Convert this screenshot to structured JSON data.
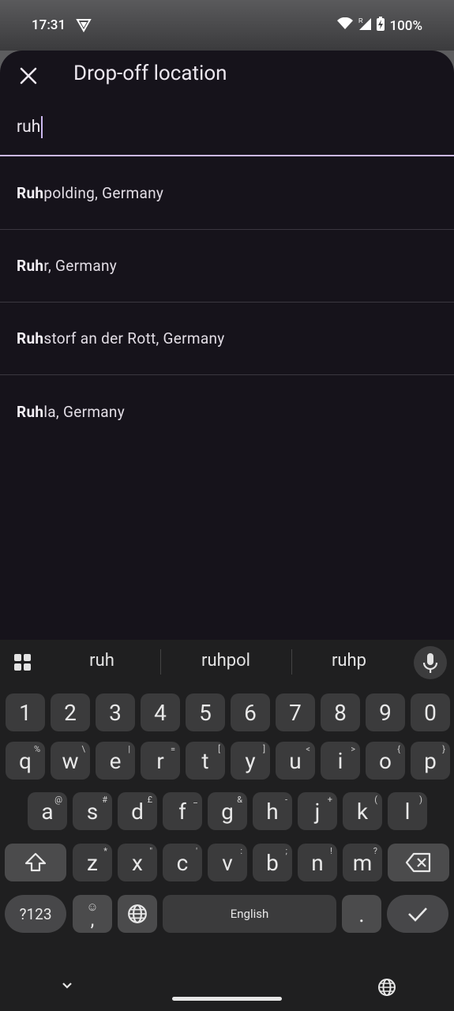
{
  "status_bar": {
    "time": "17:31",
    "battery": "100%",
    "vpn_icon": "vpn-shield-icon",
    "wifi_icon": "wifi-icon",
    "signal_icon": "signal-roaming-icon",
    "battery_icon": "battery-charging-icon"
  },
  "sheet": {
    "title": "Drop-off location",
    "close_icon": "close-icon"
  },
  "search": {
    "value": "ruh"
  },
  "results": [
    {
      "match": "Ruh",
      "rest": "polding, Germany"
    },
    {
      "match": "Ruh",
      "rest": "r, Germany"
    },
    {
      "match": "Ruh",
      "rest": "storf an der Rott, Germany"
    },
    {
      "match": "Ruh",
      "rest": "la, Germany"
    }
  ],
  "keyboard": {
    "suggestions": [
      "ruh",
      "ruhpol",
      "ruhp"
    ],
    "numbers": [
      "1",
      "2",
      "3",
      "4",
      "5",
      "6",
      "7",
      "8",
      "9",
      "0"
    ],
    "row1": [
      {
        "k": "q",
        "s": "%"
      },
      {
        "k": "w",
        "s": "\\"
      },
      {
        "k": "e",
        "s": "|"
      },
      {
        "k": "r",
        "s": "="
      },
      {
        "k": "t",
        "s": "["
      },
      {
        "k": "y",
        "s": "]"
      },
      {
        "k": "u",
        "s": "<"
      },
      {
        "k": "i",
        "s": ">"
      },
      {
        "k": "o",
        "s": "{"
      },
      {
        "k": "p",
        "s": "}"
      }
    ],
    "row2": [
      {
        "k": "a",
        "s": "@"
      },
      {
        "k": "s",
        "s": "#"
      },
      {
        "k": "d",
        "s": "£"
      },
      {
        "k": "f",
        "s": "_"
      },
      {
        "k": "g",
        "s": "&"
      },
      {
        "k": "h",
        "s": "-"
      },
      {
        "k": "j",
        "s": "+"
      },
      {
        "k": "k",
        "s": "("
      },
      {
        "k": "l",
        "s": ")"
      }
    ],
    "row3": [
      {
        "k": "z",
        "s": "*"
      },
      {
        "k": "x",
        "s": "\""
      },
      {
        "k": "c",
        "s": "'"
      },
      {
        "k": "v",
        "s": ":"
      },
      {
        "k": "b",
        "s": ";"
      },
      {
        "k": "n",
        "s": "!"
      },
      {
        "k": "m",
        "s": "?"
      }
    ],
    "symbols_label": "?123",
    "emoji_comma_label": ",",
    "space_label": "English",
    "period_label": ".",
    "icons": {
      "apps": "apps-grid-icon",
      "mic": "mic-icon",
      "shift": "shift-icon",
      "backspace": "backspace-icon",
      "globe": "globe-icon",
      "enter": "check-icon",
      "emoji": "emoji-icon"
    }
  },
  "nav_bar": {
    "down_icon": "chevron-down-icon",
    "globe_icon": "globe-icon"
  },
  "colors": {
    "sheet_bg": "#16131b",
    "accent": "#cbb8ef",
    "keyboard_bg": "#1f1f20",
    "key_bg": "#3b3b3c"
  }
}
